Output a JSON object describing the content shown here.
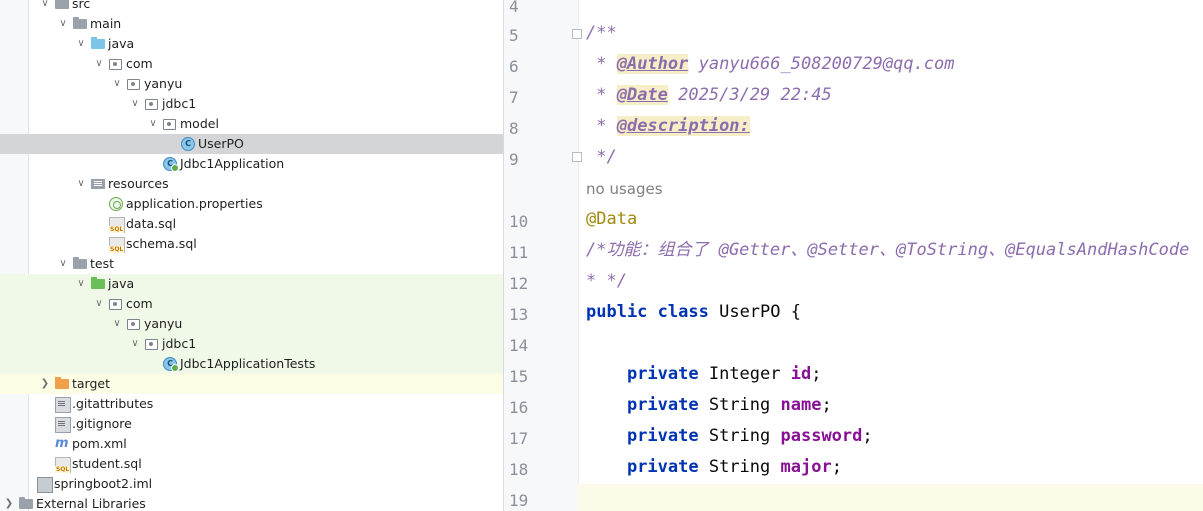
{
  "project_tree": {
    "items": [
      {
        "label": "src",
        "icon": "folder-grey",
        "arrow": "down"
      },
      {
        "label": "main",
        "icon": "folder-grey",
        "arrow": "down"
      },
      {
        "label": "java",
        "icon": "folder-blue",
        "arrow": "down"
      },
      {
        "label": "com",
        "icon": "package",
        "arrow": "down"
      },
      {
        "label": "yanyu",
        "icon": "package",
        "arrow": "down"
      },
      {
        "label": "jdbc1",
        "icon": "package",
        "arrow": "down"
      },
      {
        "label": "model",
        "icon": "package",
        "arrow": "down"
      },
      {
        "label": "UserPO",
        "icon": "class",
        "arrow": "",
        "selected": true
      },
      {
        "label": "Jdbc1Application",
        "icon": "class-app",
        "arrow": ""
      },
      {
        "label": "resources",
        "icon": "resources-folder",
        "arrow": "down"
      },
      {
        "label": "application.properties",
        "icon": "properties-file",
        "arrow": ""
      },
      {
        "label": "data.sql",
        "icon": "sql-file",
        "arrow": ""
      },
      {
        "label": "schema.sql",
        "icon": "sql-file",
        "arrow": ""
      },
      {
        "label": "test",
        "icon": "folder-grey",
        "arrow": "down"
      },
      {
        "label": "java",
        "icon": "folder-green",
        "arrow": "down"
      },
      {
        "label": "com",
        "icon": "package",
        "arrow": "down"
      },
      {
        "label": "yanyu",
        "icon": "package",
        "arrow": "down"
      },
      {
        "label": "jdbc1",
        "icon": "package",
        "arrow": "down"
      },
      {
        "label": "Jdbc1ApplicationTests",
        "icon": "class-app",
        "arrow": ""
      },
      {
        "label": "target",
        "icon": "folder-orange",
        "arrow": "right"
      },
      {
        "label": ".gitattributes",
        "icon": "git-file",
        "arrow": ""
      },
      {
        "label": ".gitignore",
        "icon": "git-file",
        "arrow": ""
      },
      {
        "label": "pom.xml",
        "icon": "maven-file",
        "arrow": ""
      },
      {
        "label": "student.sql",
        "icon": "sql-file",
        "arrow": ""
      },
      {
        "label": "springboot2.iml",
        "icon": "iml-file",
        "arrow": ""
      },
      {
        "label": "External Libraries",
        "icon": "libraries",
        "arrow": "right"
      }
    ]
  },
  "editor": {
    "line_numbers": [
      "4",
      "5",
      "6",
      "7",
      "8",
      "9",
      "10",
      "11",
      "12",
      "13",
      "14",
      "15",
      "16",
      "17",
      "18",
      "19"
    ],
    "doc_open": "/**",
    "author_tag": "@Author",
    "author_value": "yanyu666_508200729@qq.com",
    "date_tag": "@Date",
    "date_value": "2025/3/29 22:45",
    "description_tag": "@description:",
    "doc_close": " */",
    "doc_star": " * ",
    "usages_hint": "no usages",
    "annotation": "@Data",
    "comment_line": "/*功能：组合了 @Getter、@Setter、@ToString、@EqualsAndHashCode",
    "comment_end": "* */",
    "class_kw1": "public",
    "class_kw2": "class",
    "class_name": " UserPO {",
    "fields": [
      {
        "kw": "private",
        "type": " Integer ",
        "name": "id",
        "end": ";"
      },
      {
        "kw": "private",
        "type": " String ",
        "name": "name",
        "end": ";"
      },
      {
        "kw": "private",
        "type": " String ",
        "name": "password",
        "end": ";"
      },
      {
        "kw": "private",
        "type": " String ",
        "name": "major",
        "end": ";"
      }
    ]
  },
  "colors": {
    "selection": "#d4d5d8",
    "test_bg": "#f0f9e8",
    "keyword": "#0033b3",
    "doc_comment": "#8c6cae",
    "field": "#871094",
    "annotation": "#9e880d"
  }
}
